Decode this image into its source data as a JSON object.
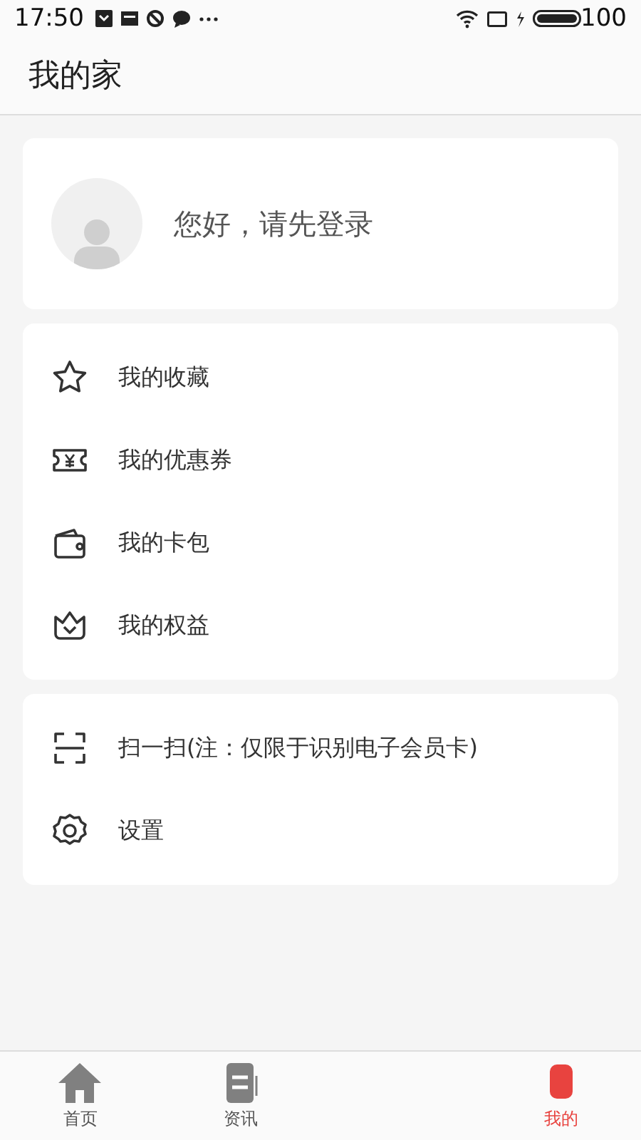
{
  "status_bar": {
    "time": "17:50",
    "battery": "100"
  },
  "header": {
    "title": "我的家"
  },
  "profile": {
    "greeting": "您好，请先登录"
  },
  "menu_groups": [
    {
      "items": [
        {
          "label": "我的收藏",
          "kind": "star"
        },
        {
          "label": "我的优惠券",
          "kind": "coupon"
        },
        {
          "label": "我的卡包",
          "kind": "wallet"
        },
        {
          "label": "我的权益",
          "kind": "crown"
        }
      ]
    },
    {
      "items": [
        {
          "label": "扫一扫(注：仅限于识别电子会员卡)",
          "kind": "scan"
        },
        {
          "label": "设置",
          "kind": "gear"
        }
      ]
    }
  ],
  "tabs": [
    {
      "label": "首页",
      "kind": "home",
      "selected": false
    },
    {
      "label": "资讯",
      "kind": "news",
      "selected": false
    },
    {
      "label": "我的",
      "kind": "me",
      "selected": true
    }
  ]
}
